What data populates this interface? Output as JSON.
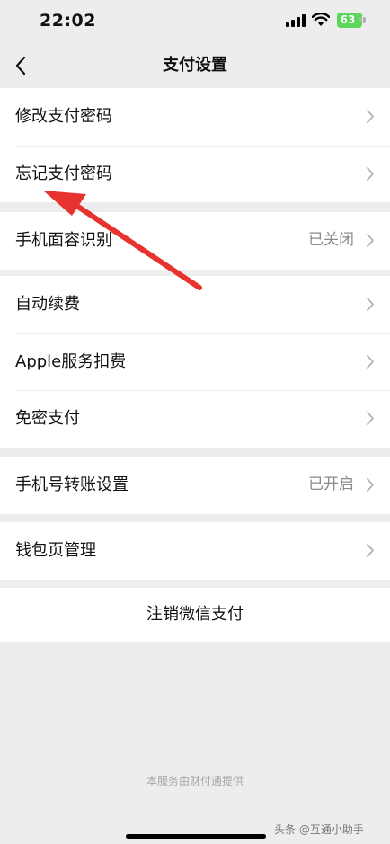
{
  "status_bar": {
    "time": "22:02",
    "battery_level": "63",
    "signal_icon": "cellular-signal-icon",
    "wifi_icon": "wifi-icon",
    "battery_color": "#5bd65b"
  },
  "nav": {
    "title": "支付设置",
    "back_icon": "chevron-left-icon"
  },
  "groups": {
    "password": {
      "change_password": "修改支付密码",
      "forgot_password": "忘记支付密码"
    },
    "biometrics": {
      "face_id": "手机面容识别",
      "face_id_status": "已关闭"
    },
    "deductions": {
      "auto_renewal": "自动续费",
      "apple_services": "Apple服务扣费",
      "password_free": "免密支付"
    },
    "transfer": {
      "phone_transfer": "手机号转账设置",
      "phone_transfer_status": "已开启"
    },
    "wallet": {
      "wallet_management": "钱包页管理"
    },
    "deregister": {
      "label": "注销微信支付"
    }
  },
  "footer": {
    "provider": "本服务由财付通提供"
  },
  "watermark": {
    "text": "头条 @互通小助手"
  },
  "annotation": {
    "arrow_color": "#e8322f",
    "arrow_icon": "red-annotation-arrow-icon"
  }
}
